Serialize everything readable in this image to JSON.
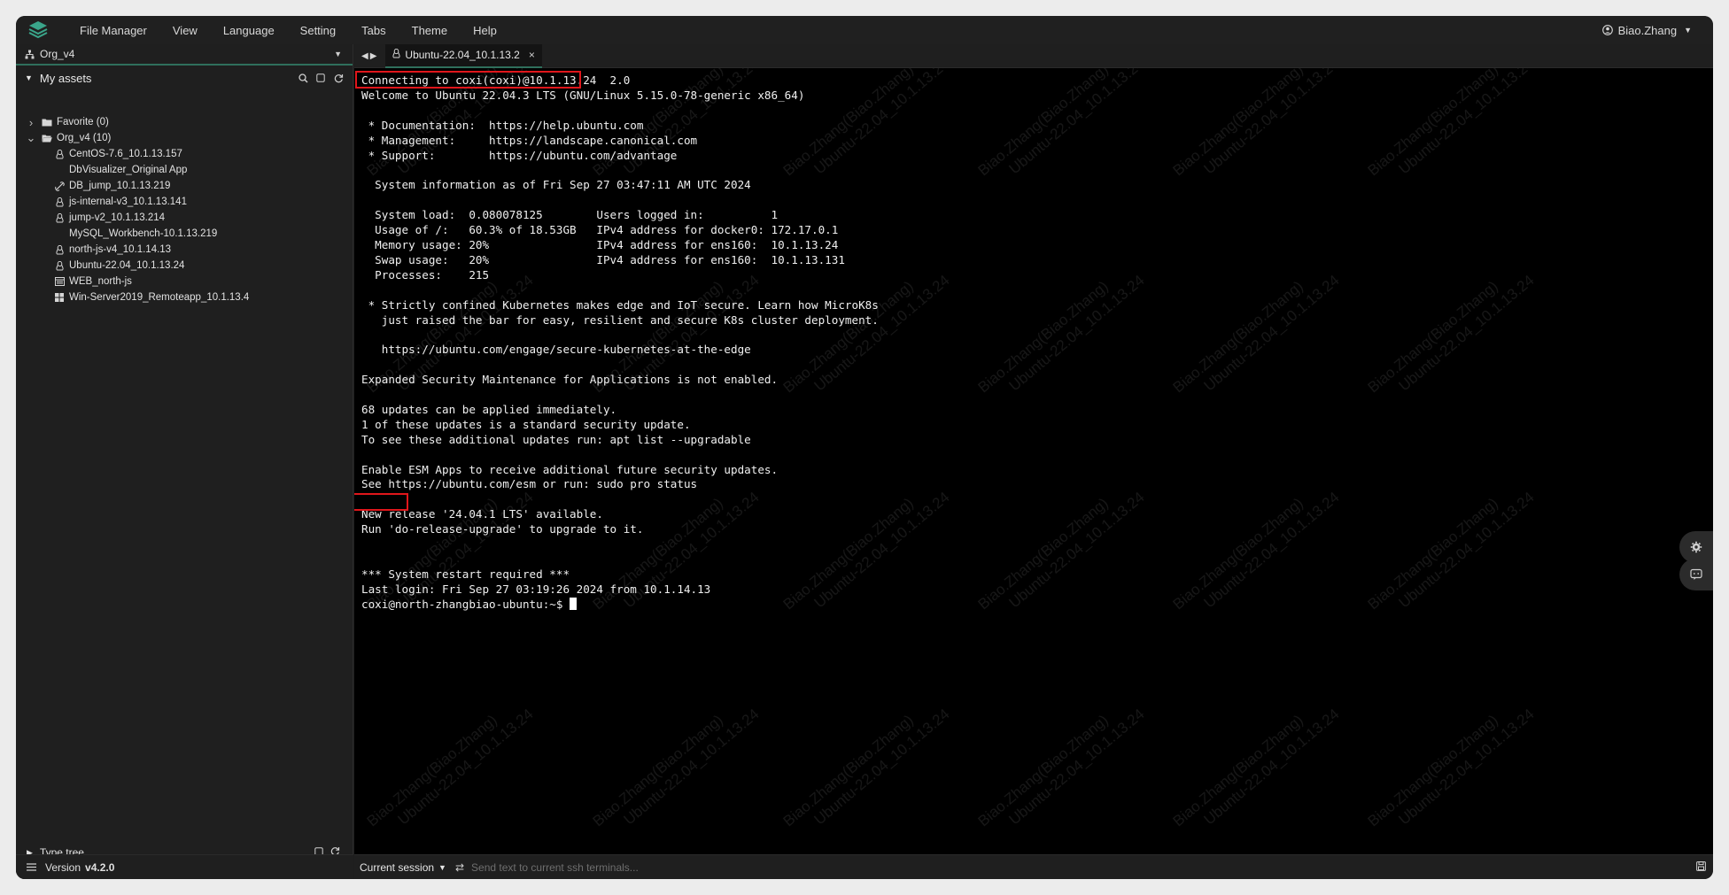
{
  "menu": [
    "File Manager",
    "View",
    "Language",
    "Setting",
    "Tabs",
    "Theme",
    "Help"
  ],
  "user": {
    "name": "Biao.Zhang"
  },
  "sidebar": {
    "org": "Org_v4",
    "assets_title": "My assets",
    "tree": [
      {
        "label": "Favorite (0)",
        "level": 0,
        "icon": "folder-icon",
        "expander": "collapsed"
      },
      {
        "label": "Org_v4 (10)",
        "level": 0,
        "icon": "folder-open-icon",
        "expander": "expanded"
      },
      {
        "label": "CentOS-7.6_10.1.13.157",
        "level": 1,
        "icon": "linux-icon"
      },
      {
        "label": "DbVisualizer_Original App",
        "level": 1,
        "icon": ""
      },
      {
        "label": "DB_jump_10.1.13.219",
        "level": 1,
        "icon": "link-icon"
      },
      {
        "label": "js-internal-v3_10.1.13.141",
        "level": 1,
        "icon": "linux-icon"
      },
      {
        "label": "jump-v2_10.1.13.214",
        "level": 1,
        "icon": "linux-icon"
      },
      {
        "label": "MySQL_Workbench-10.1.13.219",
        "level": 1,
        "icon": ""
      },
      {
        "label": "north-js-v4_10.1.14.13",
        "level": 1,
        "icon": "linux-icon"
      },
      {
        "label": "Ubuntu-22.04_10.1.13.24",
        "level": 1,
        "icon": "linux-icon"
      },
      {
        "label": "WEB_north-js",
        "level": 1,
        "icon": "web-icon"
      },
      {
        "label": "Win-Server2019_Remoteapp_10.1.13.4",
        "level": 1,
        "icon": "windows-icon"
      }
    ],
    "type_tree": "Type tree",
    "version_label": "Version",
    "version_value": "v4.2.0"
  },
  "tab": {
    "title": "Ubuntu-22.04_10.1.13.2"
  },
  "terminal": {
    "lines": [
      "Connecting to coxi(coxi)@10.1.13.24  2.0",
      "Welcome to Ubuntu 22.04.3 LTS (GNU/Linux 5.15.0-78-generic x86_64)",
      "",
      " * Documentation:  https://help.ubuntu.com",
      " * Management:     https://landscape.canonical.com",
      " * Support:        https://ubuntu.com/advantage",
      "",
      "  System information as of Fri Sep 27 03:47:11 AM UTC 2024",
      "",
      "  System load:  0.080078125        Users logged in:          1",
      "  Usage of /:   60.3% of 18.53GB   IPv4 address for docker0: 172.17.0.1",
      "  Memory usage: 20%                IPv4 address for ens160:  10.1.13.24",
      "  Swap usage:   20%                IPv4 address for ens160:  10.1.13.131",
      "  Processes:    215",
      "",
      " * Strictly confined Kubernetes makes edge and IoT secure. Learn how MicroK8s",
      "   just raised the bar for easy, resilient and secure K8s cluster deployment.",
      "",
      "   https://ubuntu.com/engage/secure-kubernetes-at-the-edge",
      "",
      "Expanded Security Maintenance for Applications is not enabled.",
      "",
      "68 updates can be applied immediately.",
      "1 of these updates is a standard security update.",
      "To see these additional updates run: apt list --upgradable",
      "",
      "Enable ESM Apps to receive additional future security updates.",
      "See https://ubuntu.com/esm or run: sudo pro status",
      "",
      "New release '24.04.1 LTS' available.",
      "Run 'do-release-upgrade' to upgrade to it.",
      "",
      "",
      "*** System restart required ***",
      "Last login: Fri Sep 27 03:19:26 2024 from 10.1.14.13"
    ],
    "prompt": "coxi@north-zhangbiao-ubuntu:~$ ",
    "watermark_line1": "Biao.Zhang(Biao.Zhang)",
    "watermark_line2": "Ubuntu-22.04_10.1.13.24"
  },
  "bottom": {
    "session_label": "Current session",
    "send_placeholder": "Send text to current ssh terminals..."
  }
}
